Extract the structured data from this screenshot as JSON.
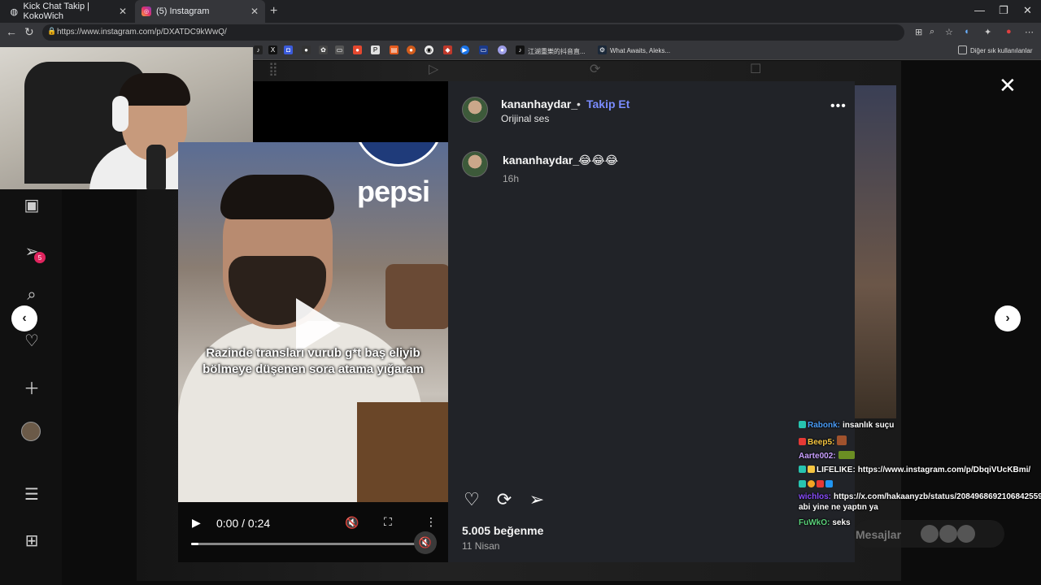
{
  "browser": {
    "tabs": [
      {
        "title": "Kick Chat Takip | KokoWich",
        "icon": "globe-icon"
      },
      {
        "title": "(5) Instagram",
        "icon": "instagram-icon"
      }
    ],
    "new_tab": "+",
    "url": "https://www.instagram.com/p/DXATDC9kWwQ/",
    "bookmarks": [
      {
        "label": "江湖重樂的抖音直...",
        "icon": "tiktok-icon"
      },
      {
        "label": "What Awaits, Aleks...",
        "icon": "steam-icon"
      }
    ],
    "other_bookmarks": "Diğer sık kullanılanlar",
    "window_controls": {
      "minimize": "—",
      "maximize": "❐",
      "close": "✕"
    }
  },
  "post": {
    "username": "kananhaydar_",
    "dot": "•",
    "follow_label": "Takip Et",
    "audio": "Orijinal ses",
    "caption_user": "kananhaydar_",
    "caption_text": "😂😂😂",
    "caption_time": "16h",
    "likes": "5.005 beğenme",
    "date": "11 Nisan"
  },
  "video": {
    "sign_text": "pepsi",
    "subtitle": "Razinde transları vurub g*t baş eliyib bölmeye düşenen sora atama yığaram",
    "time": "0:00 / 0:24",
    "progress": 0.03
  },
  "chat": [
    {
      "user": "Rabonk:",
      "text": "insanlık suçu",
      "color": "#4a9df8"
    },
    {
      "user": "Beep5:",
      "text": "",
      "color": "#f5c542"
    },
    {
      "user": "Aarte002:",
      "text": "",
      "color": "#c9a0ff"
    },
    {
      "user": "LIFELIKE:",
      "text": "https://www.instagram.com/p/DbqiVUcKBmi/",
      "color": "#ffffff"
    },
    {
      "user": "wichlos:",
      "text": "https://x.com/hakaanyzb/status/2084968692106842559 abi yine ne yaptın ya",
      "color": "#8a4dff"
    },
    {
      "user": "FuWkO:",
      "text": "seks",
      "color": "#5ad17a"
    }
  ],
  "messages_label": "Mesajlar",
  "colors": {
    "accent_link": "#7a8cff",
    "panel_bg": "#212328"
  }
}
